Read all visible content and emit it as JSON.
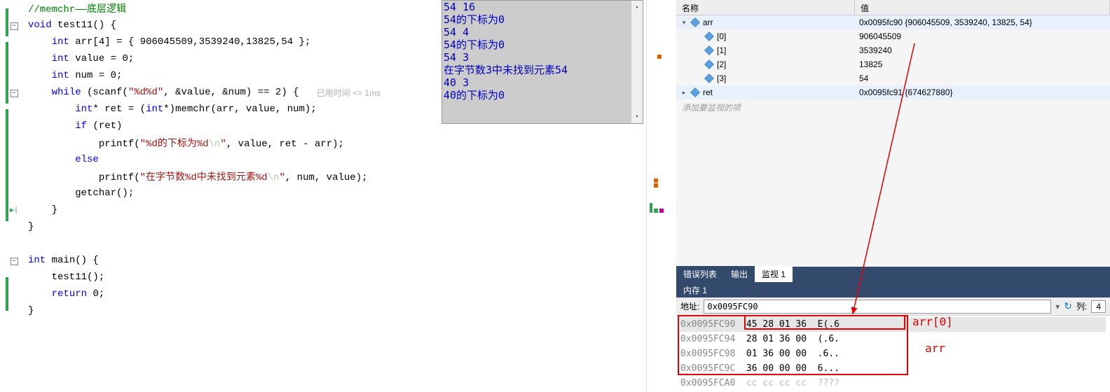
{
  "code": {
    "comment": "//memchr——底层逻辑",
    "fn_sig": "void test11() {",
    "arr_decl": "int arr[4] = { 906045509,3539240,13825,54 };",
    "value_decl": "int value = 0;",
    "num_decl": "int num = 0;",
    "while_head": "while (scanf(\"%d%d\", &value, &num) == 2) {",
    "perf_hint": "已用时间 <= 1ms",
    "ret_decl": "int* ret = (int*)memchr(arr, value, num);",
    "if_line": "if (ret)",
    "printf1": "printf(\"%d的下标为%d\\n\", value, ret - arr);",
    "else_line": "else",
    "printf2": "printf(\"在字节数%d中未找到元素%d\\n\", num, value);",
    "getchar_line": "getchar();",
    "close1": "}",
    "close2": "}",
    "main_sig": "int main() {",
    "call_test": "test11();",
    "return0": "return 0;",
    "main_close": "}"
  },
  "console": [
    "54 16",
    "54的下标为0",
    "54 4",
    "54的下标为0",
    "54 3",
    "在字节数3中未找到元素54",
    "40 3",
    "40的下标为0"
  ],
  "watch": {
    "header_name": "名称",
    "header_value": "值",
    "rows": [
      {
        "indent": 0,
        "expander": "▾",
        "name": "arr",
        "value": "0x0095fc90 {906045509, 3539240, 13825, 54}",
        "hl": true
      },
      {
        "indent": 1,
        "expander": "",
        "name": "[0]",
        "value": "906045509",
        "hl": false
      },
      {
        "indent": 1,
        "expander": "",
        "name": "[1]",
        "value": "3539240",
        "hl": false
      },
      {
        "indent": 1,
        "expander": "",
        "name": "[2]",
        "value": "13825",
        "hl": false
      },
      {
        "indent": 1,
        "expander": "",
        "name": "[3]",
        "value": "54",
        "hl": false
      },
      {
        "indent": 0,
        "expander": "▸",
        "name": "ret",
        "value": "0x0095fc91 {674627880}",
        "hl": true
      }
    ],
    "add_hint": "添加要监视的项"
  },
  "tabs": {
    "error_list": "错误列表",
    "output": "输出",
    "watch1": "监视 1"
  },
  "memory": {
    "title": "内存 1",
    "addr_label": "地址:",
    "addr_value": "0x0095FC90",
    "col_label": "列:",
    "col_value": "4",
    "rows": [
      {
        "addr": "0x0095FC90",
        "bytes": "45 28 01 36",
        "ascii": "E(.6"
      },
      {
        "addr": "0x0095FC94",
        "bytes": "28 01 36 00",
        "ascii": "(.6."
      },
      {
        "addr": "0x0095FC98",
        "bytes": "01 36 00 00",
        "ascii": ".6.."
      },
      {
        "addr": "0x0095FC9C",
        "bytes": "36 00 00 00",
        "ascii": "6..."
      },
      {
        "addr": "0x0095FCA0",
        "bytes": "cc cc cc cc",
        "ascii": "????"
      }
    ]
  },
  "annotations": {
    "arr0": "arr[0]",
    "arr": "arr"
  }
}
